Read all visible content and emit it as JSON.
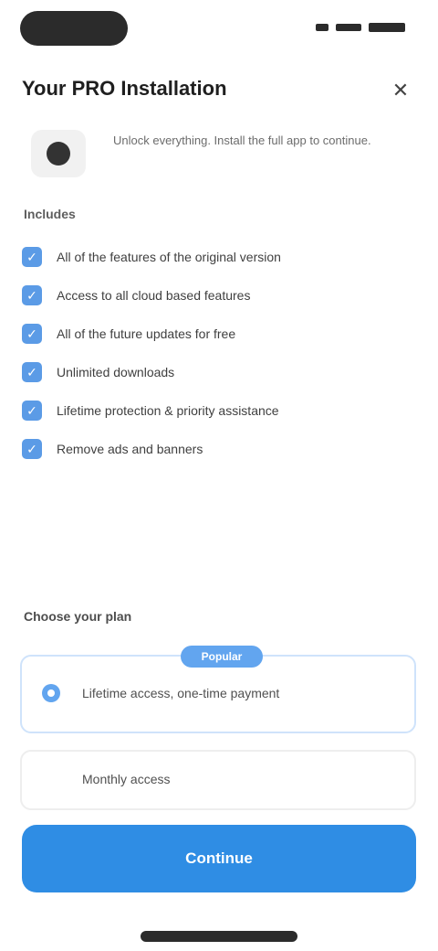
{
  "status_bar": {
    "time": ""
  },
  "header": {
    "title": "Your PRO Installation",
    "close_icon": "close-icon"
  },
  "app": {
    "icon": "app-logo-icon",
    "description": "Unlock everything. Install the full app to continue."
  },
  "permissions": {
    "label": "Includes",
    "items": [
      {
        "label": "All of the features of the original version"
      },
      {
        "label": "Access to all cloud based features"
      },
      {
        "label": "All of the future updates for free"
      },
      {
        "label": "Unlimited downloads"
      },
      {
        "label": "Lifetime protection & priority assistance"
      },
      {
        "label": "Remove ads and banners"
      }
    ]
  },
  "choose": {
    "label": "Choose your plan",
    "selected": {
      "badge": "Popular",
      "text": "Lifetime access, one-time payment"
    },
    "other": {
      "text": "Monthly access"
    }
  },
  "cta": {
    "label": "Continue"
  },
  "colors": {
    "accent": "#2f8de4",
    "check": "#5b9be6"
  }
}
